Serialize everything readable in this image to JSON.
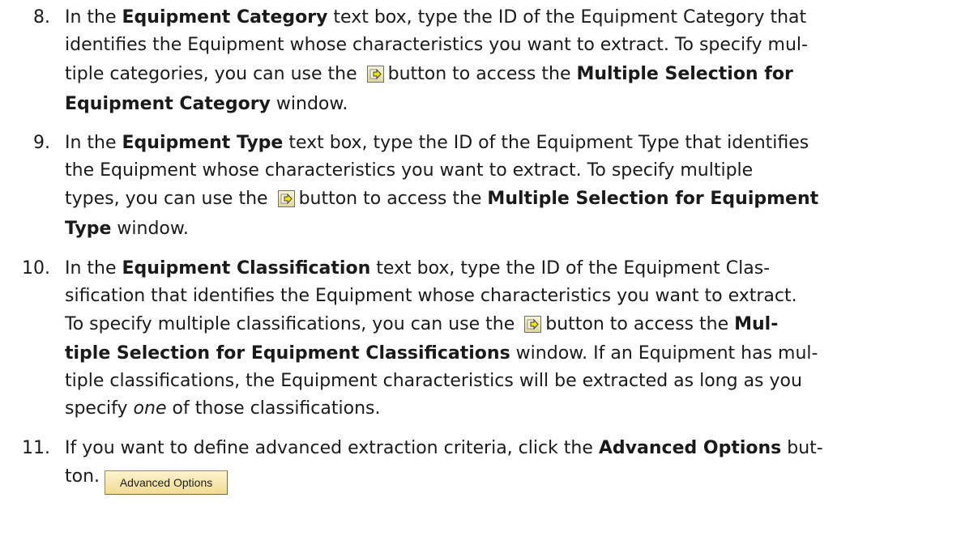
{
  "steps": [
    {
      "number": "8.",
      "lines": [
        [
          "In the ",
          "Equipment Category",
          " text box, type the ID of the Equipment Category that"
        ],
        [
          "identifies the Equipment whose characteristics you want to extract. To specify mul-"
        ],
        [
          "tiple categories, you can use the ",
          "button to access the ",
          "Multiple Selection for"
        ],
        [
          "Equipment Category",
          " window."
        ]
      ]
    },
    {
      "number": "9.",
      "lines": [
        [
          "In the ",
          "Equipment Type",
          " text box, type the ID of the Equipment Type that identifies"
        ],
        [
          "the Equipment whose characteristics you want to extract. To specify multiple"
        ],
        [
          "types, you can use the ",
          "button to access the ",
          "Multiple Selection for Equipment"
        ],
        [
          "Type",
          " window."
        ]
      ]
    },
    {
      "number": "10.",
      "lines": [
        [
          "In the ",
          "Equipment Classification",
          " text box, type the ID of the Equipment Clas-"
        ],
        [
          "sification that identifies the Equipment whose characteristics you want to extract."
        ],
        [
          "To specify multiple classifications, you can use the ",
          "button to access the ",
          "Mul-"
        ],
        [
          "tiple Selection for Equipment Classifications",
          " window. If an Equipment has mul-"
        ],
        [
          "tiple classifications, the Equipment characteristics will be extracted as long as you"
        ],
        [
          "specify ",
          "one",
          " of those classifications."
        ]
      ]
    },
    {
      "number": "11.",
      "lines": [
        [
          "If you want to define advanced extraction criteria, click the ",
          "Advanced Options",
          " but-"
        ],
        [
          "ton."
        ]
      ],
      "button_label": "Advanced Options"
    }
  ],
  "icons": {
    "multiple_selection": "multiple-selection-arrow-icon"
  },
  "colors": {
    "text": "#1a1a1a",
    "button_fill": "#f4e2a0",
    "icon_arrow": "#f2e600"
  }
}
